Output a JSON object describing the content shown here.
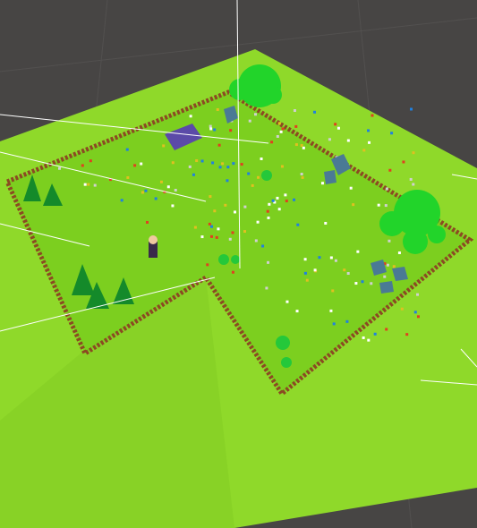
{
  "scene": {
    "view": "unity-scene-view",
    "colors": {
      "background": "#474544",
      "ground_outer": "#8fd92a",
      "ground_inner": "#7ccf1f",
      "fence": "#8b4a22",
      "tree": "#22d42a",
      "pine": "#148a2a",
      "rock": "#4a7a95",
      "gizmo_line": "#ffffff"
    },
    "objects": [
      {
        "type": "player-character",
        "icon": "character-icon"
      },
      {
        "type": "hut",
        "icon": "hut-icon"
      },
      {
        "type": "tree",
        "icon": "tree-icon"
      },
      {
        "type": "pine-tree",
        "icon": "pine-icon"
      },
      {
        "type": "rock",
        "icon": "rock-icon"
      },
      {
        "type": "bush",
        "icon": "bush-icon"
      },
      {
        "type": "fence",
        "icon": "fence-icon"
      }
    ]
  }
}
